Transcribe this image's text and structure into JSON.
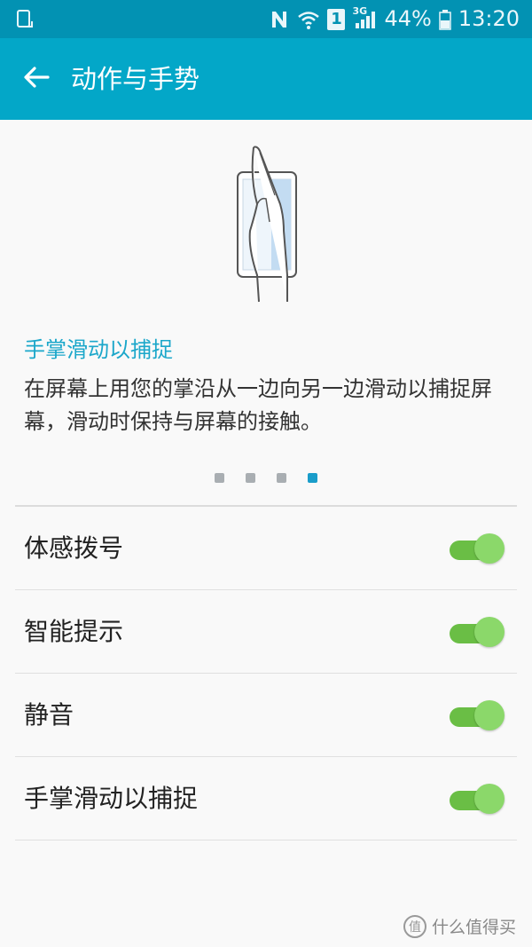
{
  "status_bar": {
    "battery": "44%",
    "time": "13:20",
    "sim_badge": "1",
    "network": "3G",
    "icons": [
      "screenshot-icon",
      "nfc-icon",
      "wifi-icon",
      "sim-icon",
      "signal-icon",
      "battery-icon"
    ]
  },
  "app_bar": {
    "title": "动作与手势",
    "back_icon": "arrow-left-icon"
  },
  "tip": {
    "title": "手掌滑动以捕捉",
    "description": "在屏幕上用您的掌沿从一边向另一边滑动以捕捉屏幕，滑动时保持与屏幕的接触。",
    "illustration_icon": "hand-swipe-illustration"
  },
  "pager": {
    "count": 4,
    "active_index": 3
  },
  "settings": [
    {
      "label": "体感拨号",
      "enabled": true
    },
    {
      "label": "智能提示",
      "enabled": true
    },
    {
      "label": "静音",
      "enabled": true
    },
    {
      "label": "手掌滑动以捕捉",
      "enabled": true
    }
  ],
  "colors": {
    "status_bar": "#0292b3",
    "app_bar": "#03a7c8",
    "accent": "#1ba7ca",
    "toggle_on_track": "#6abe45",
    "toggle_on_thumb": "#8bd86a"
  },
  "watermark": {
    "text": "什么值得买",
    "badge": "值"
  }
}
